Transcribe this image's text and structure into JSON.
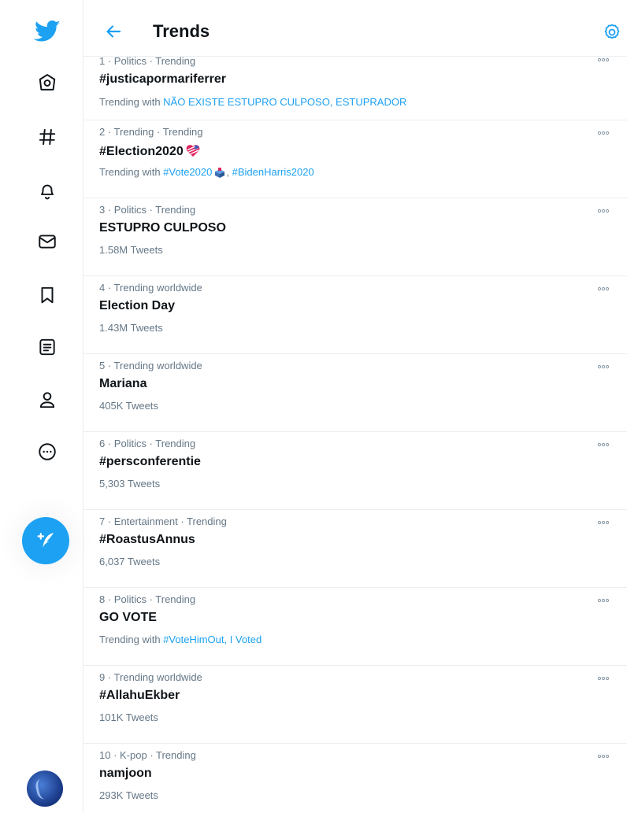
{
  "header": {
    "title": "Trends"
  },
  "sidebar": {
    "items": [
      {
        "icon": "twitter-bird-icon"
      },
      {
        "icon": "home-icon"
      },
      {
        "icon": "explore-hashtag-icon"
      },
      {
        "icon": "notifications-bell-icon"
      },
      {
        "icon": "messages-envelope-icon"
      },
      {
        "icon": "bookmarks-icon"
      },
      {
        "icon": "lists-icon"
      },
      {
        "icon": "profile-icon"
      },
      {
        "icon": "more-circle-icon"
      }
    ],
    "compose_icon": "compose-tweet-icon"
  },
  "colors": {
    "accent": "#1da1f2",
    "text": "#0f1419",
    "muted": "#657786",
    "divider": "#ebeef0"
  },
  "trends": [
    {
      "meta": "1 · Politics · Trending",
      "name": "#justicapormariferrer",
      "sub_prefix": "Trending with ",
      "sub_links": "NÃO EXISTE ESTUPRO CULPOSO, ESTUPRADOR"
    },
    {
      "meta": "2 · Trending · Trending",
      "name": "#Election2020",
      "sub_prefix": "Trending with ",
      "sub_link_1": "#Vote2020",
      "sub_sep": ", ",
      "sub_link_2": "#BidenHarris2020"
    },
    {
      "meta": "3 · Politics · Trending",
      "name": "ESTUPRO CULPOSO",
      "count": "1.58M Tweets"
    },
    {
      "meta": "4 · Trending worldwide",
      "name": "Election Day",
      "count": "1.43M Tweets"
    },
    {
      "meta": "5 · Trending worldwide",
      "name": "Mariana",
      "count": "405K Tweets"
    },
    {
      "meta": "6 · Politics · Trending",
      "name": "#persconferentie",
      "count": "5,303 Tweets"
    },
    {
      "meta": "7 · Entertainment · Trending",
      "name": "#RoastusAnnus",
      "count": "6,037 Tweets"
    },
    {
      "meta": "8 · Politics · Trending",
      "name": "GO VOTE",
      "sub_prefix": "Trending with ",
      "sub_links": "#VoteHimOut, I Voted"
    },
    {
      "meta": "9 · Trending worldwide",
      "name": "#AllahuEkber",
      "count": "101K Tweets"
    },
    {
      "meta": "10 · K-pop · Trending",
      "name": "namjoon",
      "count": "293K Tweets"
    }
  ]
}
